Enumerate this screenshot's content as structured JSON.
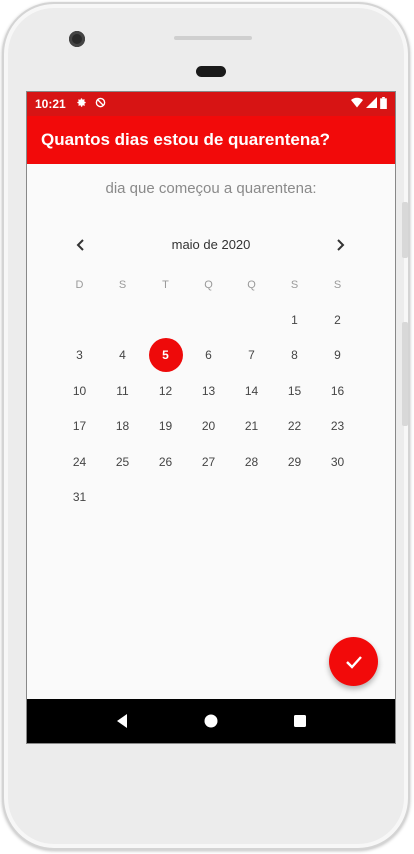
{
  "statusbar": {
    "time": "10:21",
    "icons": [
      "gear-icon",
      "do-not-disturb-icon",
      "wifi-icon",
      "signal-icon",
      "battery-icon"
    ]
  },
  "appbar": {
    "title": "Quantos dias estou de quarentena?"
  },
  "prompt": "dia que começou a quarentena:",
  "calendar": {
    "month_label": "maio de 2020",
    "weekdays": [
      "D",
      "S",
      "T",
      "Q",
      "Q",
      "S",
      "S"
    ],
    "weeks": [
      [
        "",
        "",
        "",
        "",
        "",
        "1",
        "2"
      ],
      [
        "3",
        "4",
        "5",
        "6",
        "7",
        "8",
        "9"
      ],
      [
        "10",
        "11",
        "12",
        "13",
        "14",
        "15",
        "16"
      ],
      [
        "17",
        "18",
        "19",
        "20",
        "21",
        "22",
        "23"
      ],
      [
        "24",
        "25",
        "26",
        "27",
        "28",
        "29",
        "30"
      ],
      [
        "31",
        "",
        "",
        "",
        "",
        "",
        ""
      ]
    ],
    "selected_day": "5"
  },
  "colors": {
    "accent": "#f20a0a",
    "statusbar": "#d71414"
  }
}
